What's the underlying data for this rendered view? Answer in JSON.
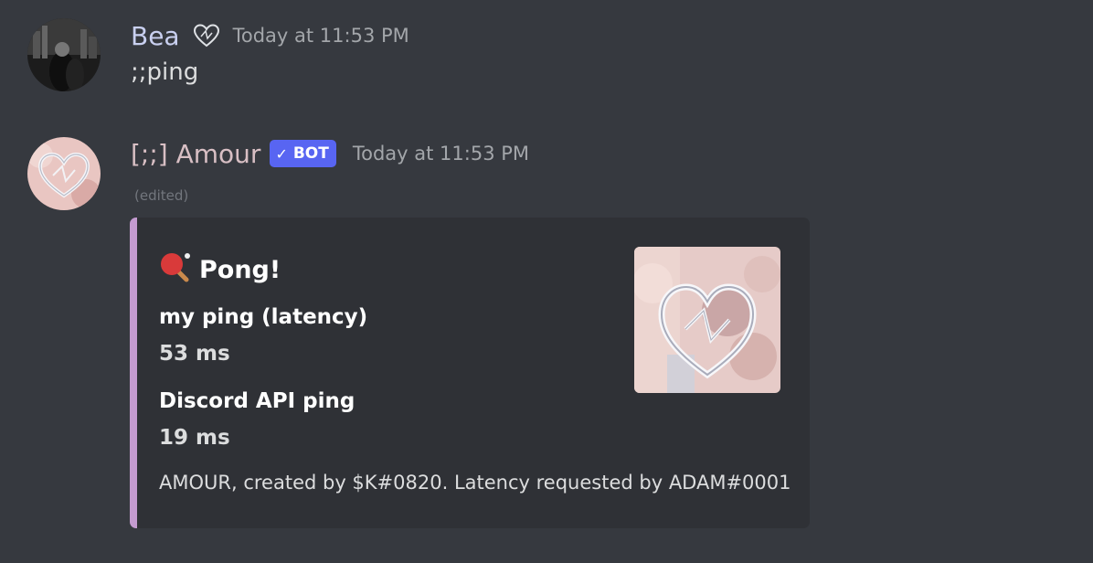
{
  "colors": {
    "background": "#36393f",
    "embed_background": "#2f3136",
    "embed_accent": "#c49bd0",
    "bot_tag": "#5865f2",
    "bea_name": "#c9d0f0",
    "amour_name": "#d8bfc4"
  },
  "messages": [
    {
      "author": "Bea",
      "badge_icon": "heart-badge-icon",
      "timestamp": "Today at 11:53 PM",
      "content": ";;ping"
    },
    {
      "author": "[;;] Amour",
      "bot_tag": "BOT",
      "bot_tag_icon": "checkmark-icon",
      "timestamp": "Today at 11:53 PM",
      "edited": "(edited)",
      "embed": {
        "title_icon": "ping-pong-paddle-icon",
        "title": "Pong!",
        "fields": [
          {
            "name": "my ping (latency)",
            "value": "53 ms"
          },
          {
            "name": "Discord API ping",
            "value": "19 ms"
          }
        ],
        "footer": "AMOUR, created by $K#0820. Latency requested by ADAM#0001",
        "thumbnail_icon": "heart-logo-icon"
      }
    }
  ]
}
